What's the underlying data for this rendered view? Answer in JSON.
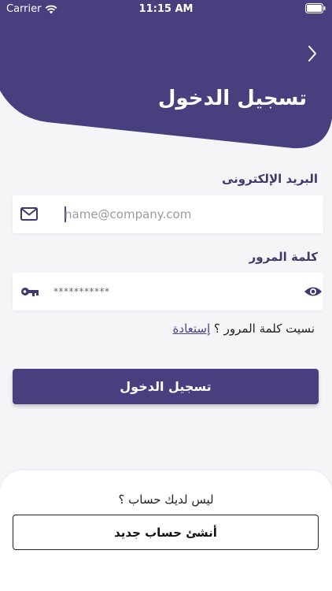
{
  "status_bar": {
    "carrier": "Carrier",
    "time": "11:15 AM"
  },
  "header": {
    "title": "تسجيل الدخول",
    "back_icon": "chevron-right-icon",
    "color": "#473f7e"
  },
  "email": {
    "label": "البريد الإلكترونى",
    "placeholder": "name@company.com",
    "icon": "mail-icon"
  },
  "password": {
    "label": "كلمة المرور",
    "value": "***********",
    "icon": "key-icon",
    "toggle_icon": "eye-icon"
  },
  "forgot": {
    "text": "نسيت كلمة المرور ؟",
    "link": "إستعادة"
  },
  "login_button": {
    "label": "تسجيل الدخول"
  },
  "signup": {
    "prompt": "ليس لديك حساب ؟",
    "button": "أنشئ حساب جديد"
  }
}
